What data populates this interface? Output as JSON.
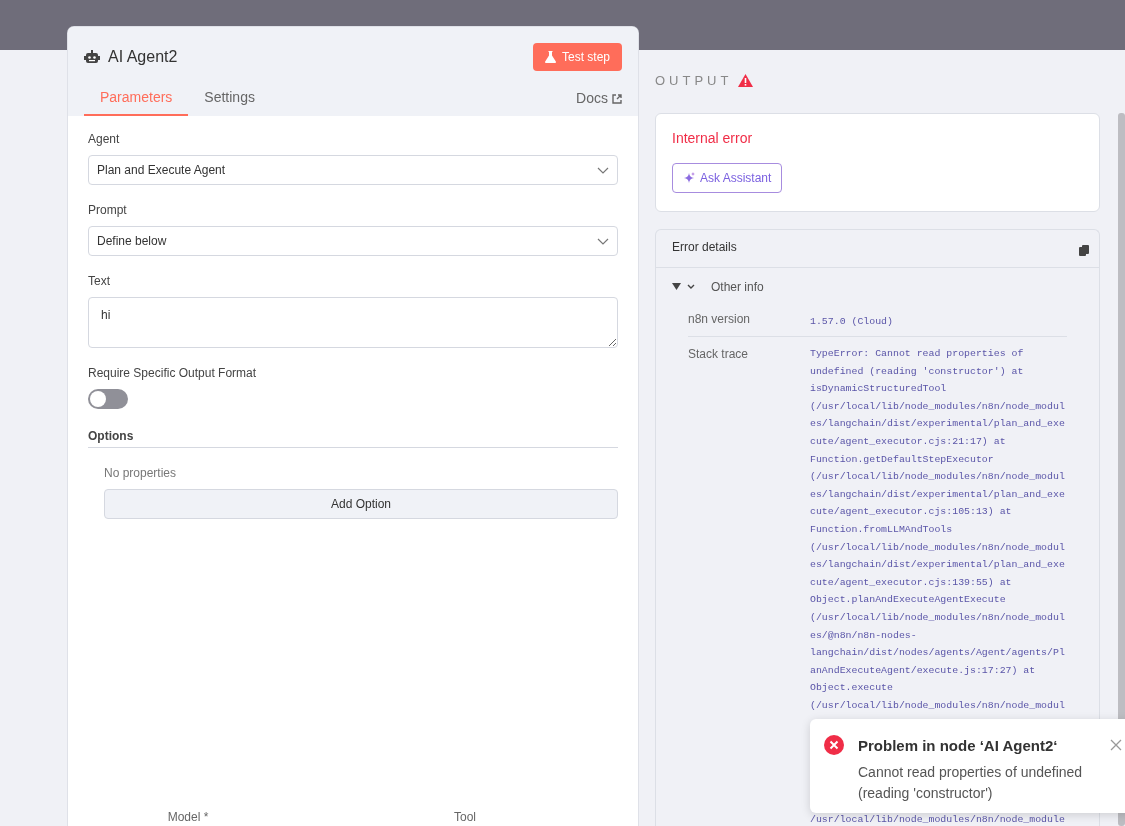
{
  "node_panel": {
    "title": "AI Agent2",
    "test_button": "Test step",
    "tabs": [
      {
        "label": "Parameters",
        "selected": true
      },
      {
        "label": "Settings",
        "selected": false
      }
    ],
    "docs_link": "Docs",
    "fields": [
      {
        "kind": "select",
        "label": "Agent",
        "value": "Plan and Execute Agent"
      },
      {
        "kind": "select",
        "label": "Prompt",
        "value": "Define below"
      },
      {
        "kind": "textarea",
        "label": "Text",
        "value": "hi"
      },
      {
        "kind": "toggle",
        "label": "Require Specific Output Format",
        "on": false
      }
    ],
    "options": {
      "heading": "Options",
      "empty_text": "No properties",
      "add_button": "Add Option"
    },
    "connectors": [
      "Model *",
      "Tool"
    ]
  },
  "output": {
    "heading": "OUTPUT",
    "error_title": "Internal error",
    "assistant_button": "Ask Assistant",
    "details": {
      "heading": "Error details",
      "section": {
        "label": "Other info",
        "expanded": true
      },
      "rows": [
        {
          "label": "n8n version",
          "lines": [
            "1.57.0 (Cloud)"
          ]
        },
        {
          "label": "Stack trace",
          "lines": [
            "TypeError: Cannot read properties of",
            "undefined (reading 'constructor') at",
            "isDynamicStructuredTool",
            "(/usr/local/lib/node_modules/n8n/node_modul",
            "es/langchain/dist/experimental/plan_and_exe",
            "cute/agent_executor.cjs:21:17) at",
            "Function.getDefaultStepExecutor",
            "(/usr/local/lib/node_modules/n8n/node_modul",
            "es/langchain/dist/experimental/plan_and_exe",
            "cute/agent_executor.cjs:105:13) at",
            "Function.fromLLMAndTools",
            "(/usr/local/lib/node_modules/n8n/node_modul",
            "es/langchain/dist/experimental/plan_and_exe",
            "cute/agent_executor.cjs:139:55) at",
            "Object.planAndExecuteAgentExecute",
            "(/usr/local/lib/node_modules/n8n/node_modul",
            "es/@n8n/n8n-nodes-",
            "langchain/dist/nodes/agents/Agent/agents/Pl",
            "anAndExecuteAgent/execute.js:17:27) at",
            "Object.execute",
            "(/usr/local/lib/node_modules/n8n/node_modul"
          ],
          "lines_below_toast": [
            "/usr/local/lib/node_modules/n8n/node_module"
          ]
        }
      ]
    }
  },
  "toast": {
    "title": "Problem in node ‘AI Agent2‘",
    "message": "Cannot read properties of undefined (reading 'constructor')"
  }
}
